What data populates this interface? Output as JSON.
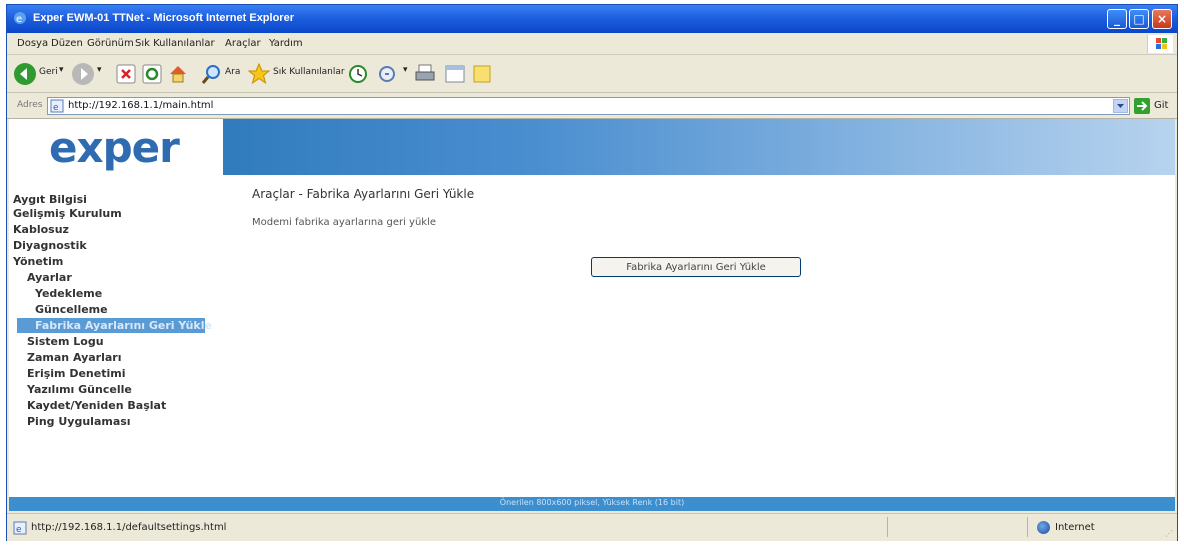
{
  "window": {
    "title": "Exper EWM-01 TTNet - Microsoft Internet Explorer"
  },
  "menubar": {
    "items": [
      "Dosya",
      "Düzen",
      "Görünüm",
      "Sık Kullanılanlar",
      "Araçlar",
      "Yardım"
    ]
  },
  "toolbar": {
    "back_label": "Geri",
    "search_label": "Ara",
    "favorites_label": "Sık Kullanılanlar"
  },
  "addressbar": {
    "label": "Adres",
    "url": "http://192.168.1.1/main.html",
    "go_label": "Git"
  },
  "page": {
    "logo_text": "exper",
    "sidebar": {
      "items": [
        {
          "label": "Aygıt Bilgisi"
        },
        {
          "label": "Gelişmiş Kurulum"
        },
        {
          "label": "Kablosuz"
        },
        {
          "label": "Diyagnostik"
        },
        {
          "label": "Yönetim"
        },
        {
          "label": "Ayarlar"
        },
        {
          "label": "Yedekleme"
        },
        {
          "label": "Güncelleme"
        },
        {
          "label": "Fabrika Ayarlarını Geri Yükle"
        },
        {
          "label": "Sistem Logu"
        },
        {
          "label": "Zaman Ayarları"
        },
        {
          "label": "Erişim Denetimi"
        },
        {
          "label": "Yazılımı Güncelle"
        },
        {
          "label": "Kaydet/Yeniden Başlat"
        },
        {
          "label": "Ping Uygulaması"
        }
      ]
    },
    "main": {
      "title": "Araçlar - Fabrika Ayarlarını Geri Yükle",
      "description": "Modemi fabrika ayarlarına geri yükle",
      "button_label": "Fabrika Ayarlarını Geri Yükle"
    },
    "footer_text": "Önerilen 800x600 piksel, Yüksek Renk (16 bit)"
  },
  "statusbar": {
    "url": "http://192.168.1.1/defaultsettings.html",
    "zone": "Internet"
  },
  "colors": {
    "titlebar": "#1d5fe0",
    "banner": "#1f6fb0",
    "active_nav": "#5a9bd6",
    "footer": "#3c8fcf"
  }
}
